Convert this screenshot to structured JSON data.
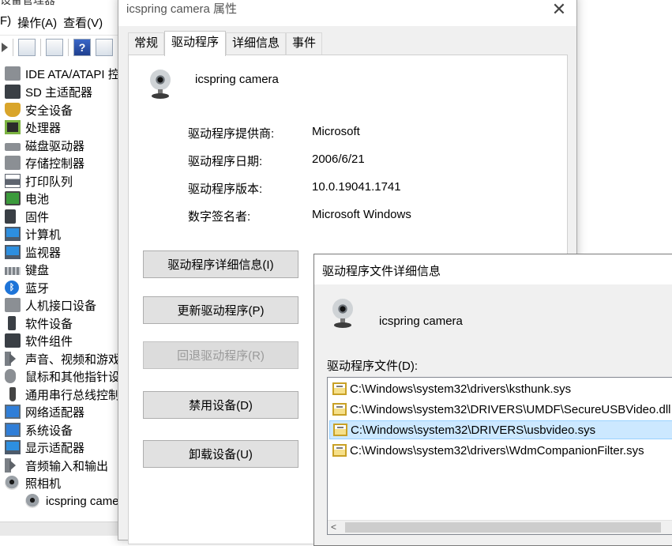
{
  "device_manager": {
    "title": "设备管理器",
    "menu": [
      "F)",
      "操作(A)",
      "查看(V)"
    ],
    "tree": [
      {
        "label": "IDE ATA/ATAPI 控",
        "icon": "ide-controller-icon"
      },
      {
        "label": "SD 主适配器",
        "icon": "sd-host-icon"
      },
      {
        "label": "安全设备",
        "icon": "security-device-icon"
      },
      {
        "label": "处理器",
        "icon": "processor-icon"
      },
      {
        "label": "磁盘驱动器",
        "icon": "disk-drive-icon"
      },
      {
        "label": "存储控制器",
        "icon": "storage-controller-icon"
      },
      {
        "label": "打印队列",
        "icon": "printer-icon"
      },
      {
        "label": "电池",
        "icon": "battery-icon"
      },
      {
        "label": "固件",
        "icon": "firmware-icon"
      },
      {
        "label": "计算机",
        "icon": "computer-icon"
      },
      {
        "label": "监视器",
        "icon": "monitor-icon"
      },
      {
        "label": "键盘",
        "icon": "keyboard-icon"
      },
      {
        "label": "蓝牙",
        "icon": "bluetooth-icon"
      },
      {
        "label": "人机接口设备",
        "icon": "hid-icon"
      },
      {
        "label": "软件设备",
        "icon": "software-device-icon"
      },
      {
        "label": "软件组件",
        "icon": "software-component-icon"
      },
      {
        "label": "声音、视频和游戏",
        "icon": "speaker-icon"
      },
      {
        "label": "鼠标和其他指针设",
        "icon": "mouse-icon"
      },
      {
        "label": "通用串行总线控制",
        "icon": "usb-icon"
      },
      {
        "label": "网络适配器",
        "icon": "network-adapter-icon"
      },
      {
        "label": "系统设备",
        "icon": "system-device-icon"
      },
      {
        "label": "显示适配器",
        "icon": "display-adapter-icon"
      },
      {
        "label": "音频输入和输出",
        "icon": "audio-io-icon"
      },
      {
        "label": "照相机",
        "icon": "camera-icon"
      },
      {
        "label": "icspring came",
        "icon": "webcam-icon"
      }
    ]
  },
  "properties_dialog": {
    "title": "icspring camera 属性",
    "close_glyph": "✕",
    "tabs": [
      "常规",
      "驱动程序",
      "详细信息",
      "事件"
    ],
    "active_tab": "驱动程序",
    "device_name": "icspring camera",
    "info": [
      {
        "label": "驱动程序提供商:",
        "value": "Microsoft"
      },
      {
        "label": "驱动程序日期:",
        "value": "2006/6/21"
      },
      {
        "label": "驱动程序版本:",
        "value": "10.0.19041.1741"
      },
      {
        "label": "数字签名者:",
        "value": "Microsoft Windows"
      }
    ],
    "buttons": [
      {
        "label": "驱动程序详细信息(I)",
        "enabled": true
      },
      {
        "label": "更新驱动程序(P)",
        "enabled": true
      },
      {
        "label": "回退驱动程序(R)",
        "enabled": false
      },
      {
        "label": "禁用设备(D)",
        "enabled": true
      },
      {
        "label": "卸载设备(U)",
        "enabled": true
      }
    ]
  },
  "driver_details_dialog": {
    "title": "驱动程序文件详细信息",
    "device_name": "icspring camera",
    "files_label": "驱动程序文件(D):",
    "files": [
      "C:\\Windows\\system32\\drivers\\ksthunk.sys",
      "C:\\Windows\\system32\\DRIVERS\\UMDF\\SecureUSBVideo.dll",
      "C:\\Windows\\system32\\DRIVERS\\usbvideo.sys",
      "C:\\Windows\\system32\\drivers\\WdmCompanionFilter.sys"
    ],
    "selected_index": 2,
    "scroll_left_glyph": "<"
  }
}
